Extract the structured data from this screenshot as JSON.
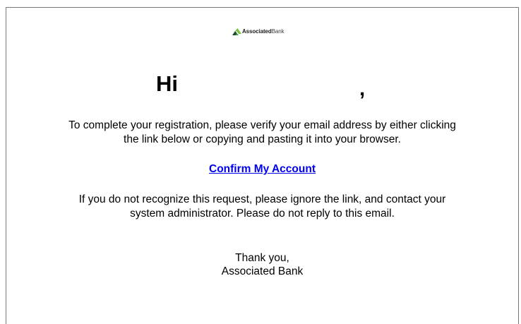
{
  "email": {
    "logo": {
      "icon": "associated-bank-logo-icon",
      "brand_bold": "Associated",
      "brand_light": "Bank",
      "colors": {
        "dark": "#1f4d2b",
        "light": "#7cc243"
      }
    },
    "greeting": "Hi",
    "greeting_comma": ",",
    "instructions": [
      "To complete your registration, please verify your email address by either clicking",
      "the link below or copying and pasting it into your browser."
    ],
    "confirm_link_label": "Confirm My Account",
    "warning": [
      "If you do not recognize this request, please ignore the link, and contact your",
      "system administrator. Please do not reply to this email."
    ],
    "signoff": {
      "line1": "Thank you,",
      "line2": "Associated Bank"
    },
    "link_color": "#0000ee",
    "frame_border_color": "#7a7a7a"
  }
}
